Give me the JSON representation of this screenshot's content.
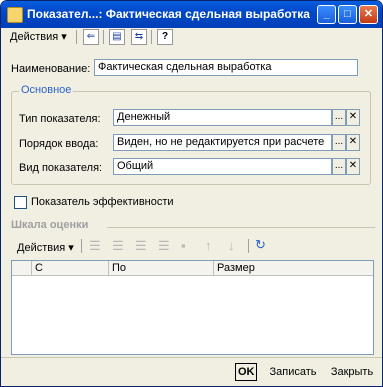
{
  "window": {
    "title": "Показател...: Фактическая сдельная выработка",
    "minimize_glyph": "_",
    "maximize_glyph": "□",
    "close_glyph": "✕"
  },
  "toolbar": {
    "actions_label": "Действия",
    "help_glyph": "?"
  },
  "form": {
    "name_label": "Наименование:",
    "name_value": "Фактическая сдельная выработка",
    "group_title": "Основное",
    "type_label": "Тип показателя:",
    "type_value": "Денежный",
    "order_label": "Порядок ввода:",
    "order_value": "Виден, но не редактируется при расчете",
    "kind_label": "Вид показателя:",
    "kind_value": "Общий",
    "select_glyph": "...",
    "clear_glyph": "✕",
    "efficiency_label": "Показатель эффективности",
    "efficiency_checked": false
  },
  "scale": {
    "title": "Шкала оценки",
    "actions_label": "Действия",
    "columns": [
      "С",
      "По",
      "Размер"
    ],
    "rows": []
  },
  "footer": {
    "ok_label": "OK",
    "save_label": "Записать",
    "close_label": "Закрыть"
  }
}
